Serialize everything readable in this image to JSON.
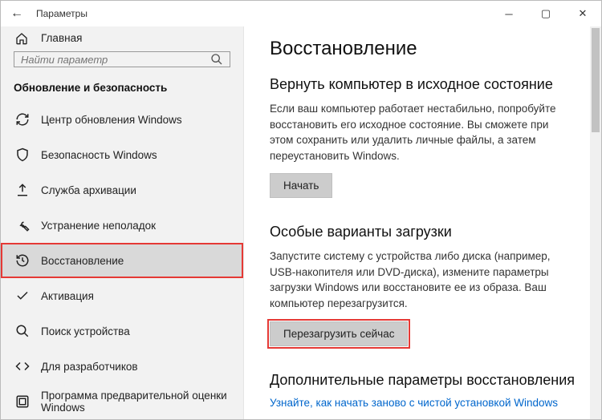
{
  "titlebar": {
    "back": "←",
    "title": "Параметры"
  },
  "sidebar": {
    "home": "Главная",
    "search_placeholder": "Найти параметр",
    "section": "Обновление и безопасность",
    "items": [
      {
        "icon": "refresh",
        "label": "Центр обновления Windows"
      },
      {
        "icon": "shield",
        "label": "Безопасность Windows"
      },
      {
        "icon": "upload",
        "label": "Служба архивации"
      },
      {
        "icon": "wrench",
        "label": "Устранение неполадок"
      },
      {
        "icon": "history",
        "label": "Восстановление"
      },
      {
        "icon": "check",
        "label": "Активация"
      },
      {
        "icon": "search",
        "label": "Поиск устройства"
      },
      {
        "icon": "dev",
        "label": "Для разработчиков"
      },
      {
        "icon": "insider",
        "label": "Программа предварительной оценки Windows"
      }
    ],
    "selected_index": 4
  },
  "content": {
    "h1": "Восстановление",
    "reset": {
      "h2": "Вернуть компьютер в исходное состояние",
      "p": "Если ваш компьютер работает нестабильно, попробуйте восстановить его исходное состояние. Вы сможете при этом сохранить или удалить личные файлы, а затем переустановить Windows.",
      "btn": "Начать"
    },
    "advanced": {
      "h2": "Особые варианты загрузки",
      "p": "Запустите систему с устройства либо диска (например, USB-накопителя или DVD-диска), измените параметры загрузки Windows или восстановите ее из образа. Ваш компьютер перезагрузится.",
      "btn": "Перезагрузить сейчас"
    },
    "more": {
      "h2": "Дополнительные параметры восстановления",
      "link": "Узнайте, как начать заново с чистой установкой Windows"
    }
  }
}
